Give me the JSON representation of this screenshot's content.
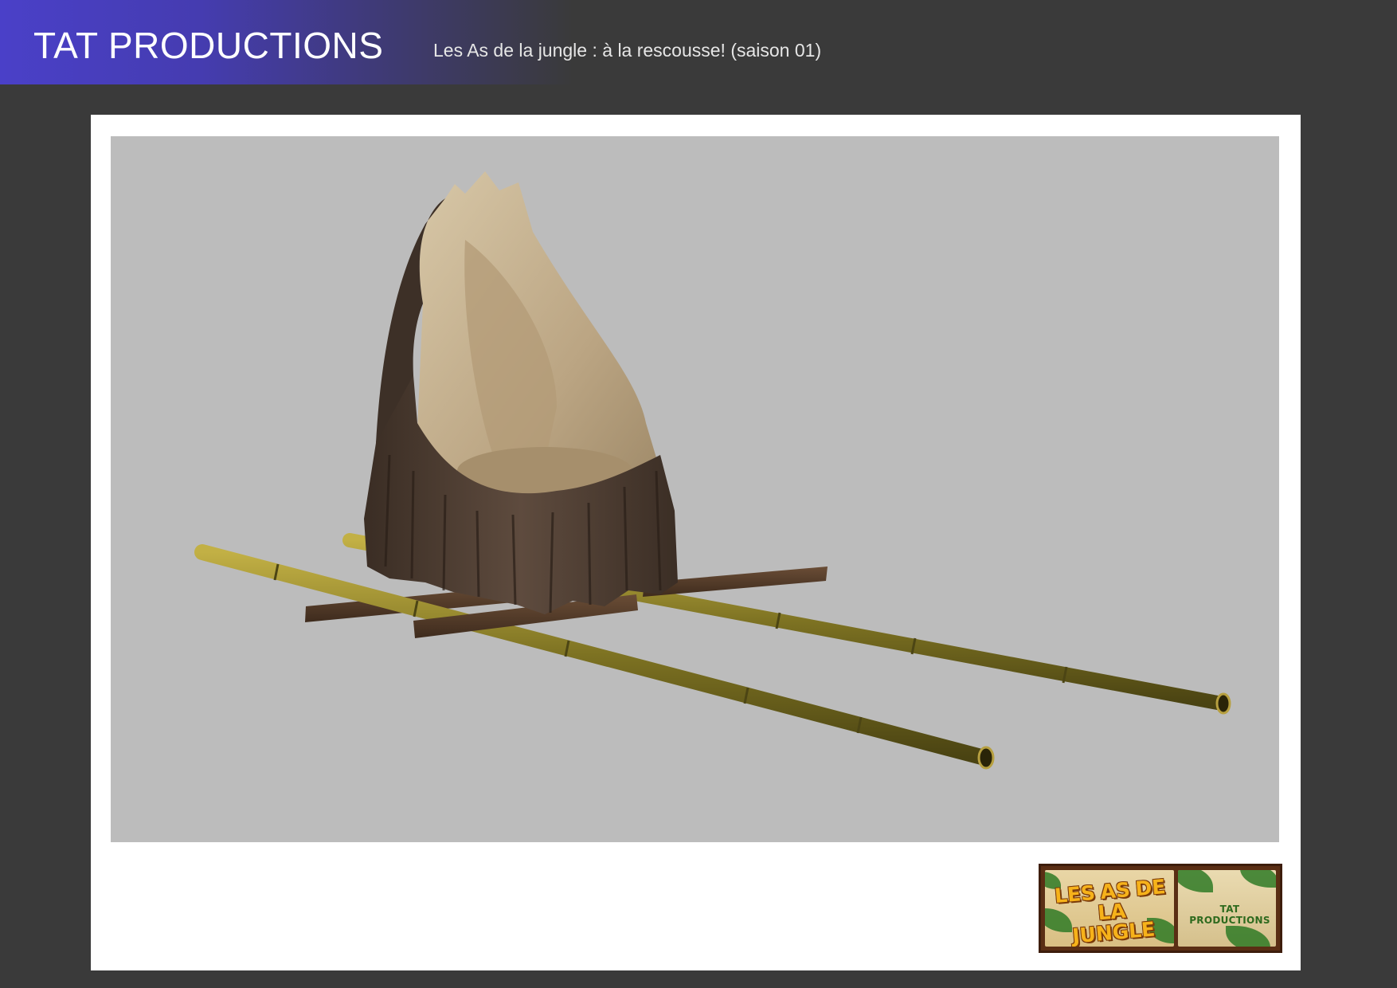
{
  "header": {
    "brand": "TAT PRODUCTIONS",
    "subtitle": "Les As de la jungle : à la rescousse! (saison 01)"
  },
  "render": {
    "subject": "wooden-throne-on-bamboo-poles"
  },
  "footer_logos": {
    "series_logo_text": "LES AS DE LA JUNGLE",
    "studio_logo_text": "TAT PRODUCTIONS"
  },
  "colors": {
    "header_accent": "#4a40c8",
    "page_background": "#3a3a3a",
    "render_background": "#bcbcbc"
  }
}
